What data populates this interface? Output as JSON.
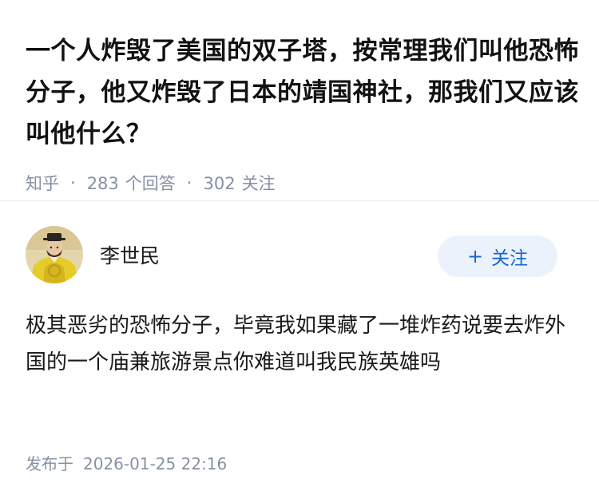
{
  "question": {
    "title": "一个人炸毁了美国的双子塔，按常理我们叫他恐怖分子，他又炸毁了日本的靖国神社，那我们又应该叫他什么？",
    "source": "知乎",
    "separator": "·",
    "answer_count": "283",
    "answer_label": "个回答",
    "follow_count": "302",
    "follow_label": "关注"
  },
  "author": {
    "name": "李世民",
    "avatar_icon": "emperor-portrait-avatar",
    "follow_icon": "plus-icon",
    "follow_plus": "+",
    "follow_label": "关注"
  },
  "answer": {
    "text": "极其恶劣的恐怖分子，毕竟我如果藏了一堆炸药说要去炸外国的一个庙兼旅游景点你难道叫我民族英雄吗"
  },
  "footer": {
    "published_label": "发布于",
    "published_time": "2026-01-25 22:16"
  },
  "colors": {
    "title": "#121212",
    "meta": "#8590a6",
    "follow_bg": "#ebf2fc",
    "follow_text": "#1766d6",
    "divider": "#ededed"
  }
}
